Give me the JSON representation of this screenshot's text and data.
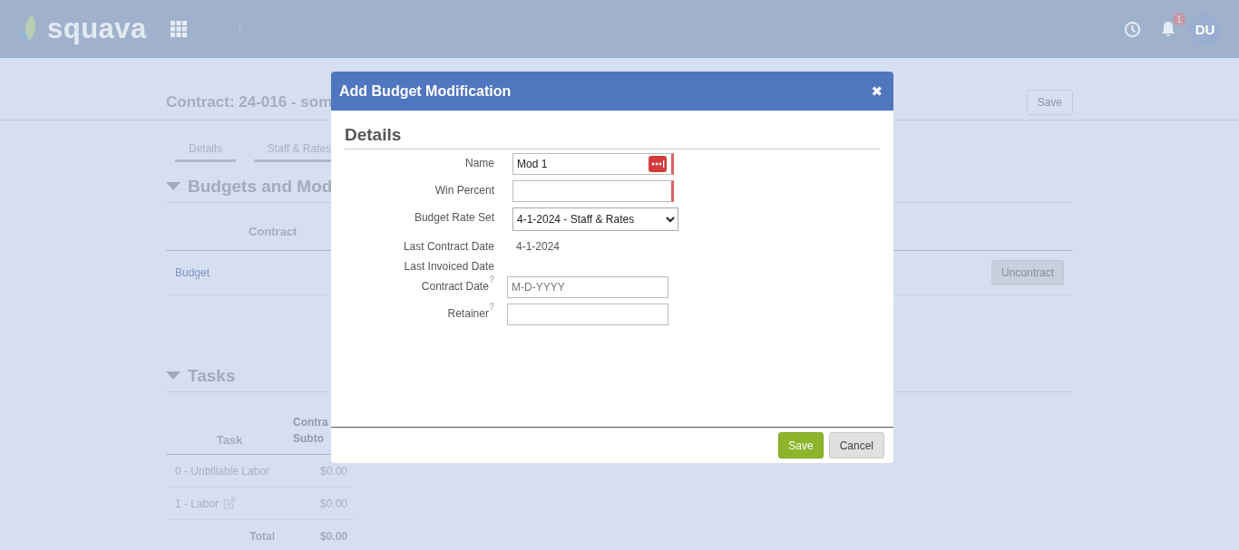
{
  "header": {
    "logo": "squava",
    "notification_count": "1",
    "avatar": "DU"
  },
  "page": {
    "title": "Contract: 24-016 - som",
    "save_button": {
      "label": "Save",
      "disabled": true
    }
  },
  "tabs": [
    {
      "label": "Details",
      "selected": false
    },
    {
      "label": "Staff & Rates",
      "selected": false
    }
  ],
  "budgets": {
    "title": "Budgets and Mod",
    "expanded": true,
    "column_1": "Contract",
    "rows": [
      {
        "name": "Budget",
        "action": "Uncontract"
      }
    ]
  },
  "tasks": {
    "title": "Tasks",
    "expanded": true,
    "column_1": "Task",
    "column_2": [
      "Contra",
      "Subto"
    ],
    "rows": [
      {
        "task": "0 - Unbillable Labor",
        "subtotal": "$0.00",
        "editable": false
      },
      {
        "task": "1 - Labor",
        "subtotal": "$0.00",
        "editable": true
      }
    ],
    "total": {
      "label": "Total",
      "value": "$0.00"
    }
  },
  "modal": {
    "title": "Add Budget Modification",
    "close": "✖",
    "section": "Details",
    "fields": [
      {
        "kind": "input",
        "label": "Name",
        "value": "Mod 1",
        "required": true,
        "menu_icon": true
      },
      {
        "kind": "input",
        "label": "Win Percent",
        "required": true,
        "menu_icon": false
      },
      {
        "kind": "select",
        "label": "Budget Rate Set",
        "value": "4-1-2024 - Staff & Rates"
      },
      {
        "kind": "static",
        "label": "Last Contract Date",
        "value": "4-1-2024"
      },
      {
        "kind": "static",
        "label": "Last Invoiced Date"
      },
      {
        "kind": "input",
        "label": "Contract Date",
        "help": "?",
        "placeholder": "M-D-YYYY",
        "required": false,
        "menu_icon": false
      },
      {
        "kind": "input",
        "label": "Retainer",
        "help": "?",
        "required": false,
        "menu_icon": false
      }
    ],
    "buttons": [
      {
        "kind": "primary",
        "label": "Save"
      },
      {
        "kind": "secondary",
        "label": "Cancel"
      }
    ]
  }
}
